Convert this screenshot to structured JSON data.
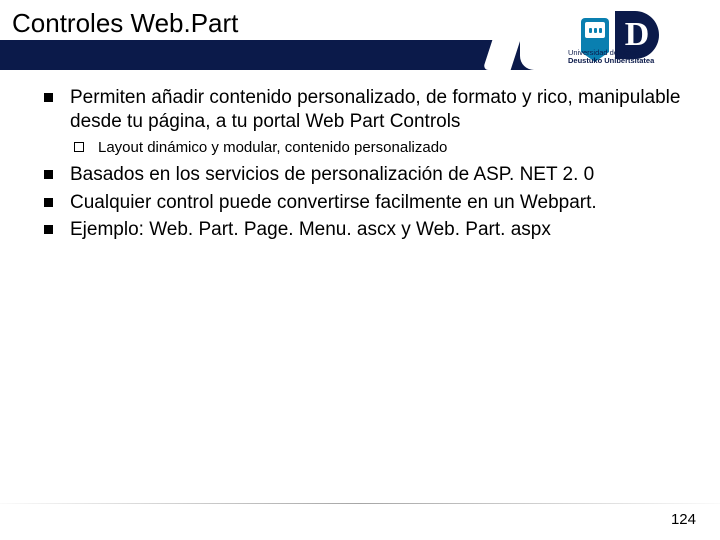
{
  "header": {
    "title": "Controles Web.Part",
    "logo": {
      "letter": "D",
      "uni_line1": "Universidad de Deusto",
      "uni_line2": "Deustuko Unibertsitatea"
    }
  },
  "bullets": {
    "b1": "Permiten añadir contenido personalizado, de formato y rico, manipulable desde tu página, a tu portal Web Part Controls",
    "b1_sub1": "Layout dinámico y modular, contenido personalizado",
    "b2": "Basados en los servicios de personalización de ASP. NET 2. 0",
    "b3": "Cualquier control puede convertirse facilmente en un Webpart.",
    "b4": "Ejemplo: Web. Part. Page. Menu. ascx y Web. Part. aspx"
  },
  "footer": {
    "page_number": "124"
  }
}
